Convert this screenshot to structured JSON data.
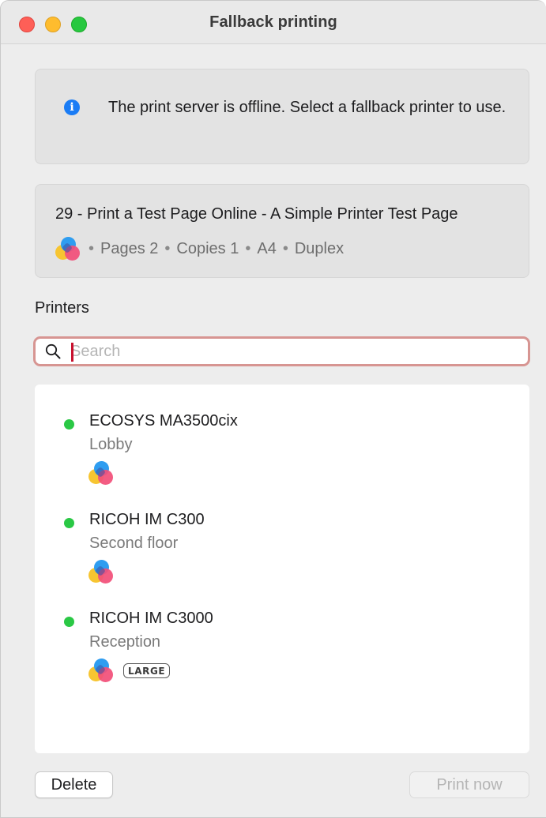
{
  "window": {
    "title": "Fallback printing"
  },
  "info": {
    "icon": "info-icon",
    "message": "The print server is offline. Select a fallback printer to use."
  },
  "job": {
    "title": "29 - Print a Test Page Online - A Simple Printer Test Page",
    "icon": "color-print-icon",
    "pages": "Pages 2",
    "copies": "Copies 1",
    "paper": "A4",
    "duplex": "Duplex",
    "separator": "•"
  },
  "printers_section": {
    "label": "Printers"
  },
  "search": {
    "placeholder": "Search",
    "value": ""
  },
  "printers": [
    {
      "name": "ECOSYS MA3500cix",
      "location": "Lobby",
      "status": "online",
      "color": true,
      "badge": ""
    },
    {
      "name": "RICOH IM C300",
      "location": "Second floor",
      "status": "online",
      "color": true,
      "badge": ""
    },
    {
      "name": "RICOH IM C3000",
      "location": "Reception",
      "status": "online",
      "color": true,
      "badge": "LARGE"
    }
  ],
  "buttons": {
    "delete": "Delete",
    "print_now": "Print now"
  },
  "colors": {
    "status_online": "#2ac845",
    "info_blue": "#1a7cf5",
    "focus_ring": "#d79592"
  }
}
